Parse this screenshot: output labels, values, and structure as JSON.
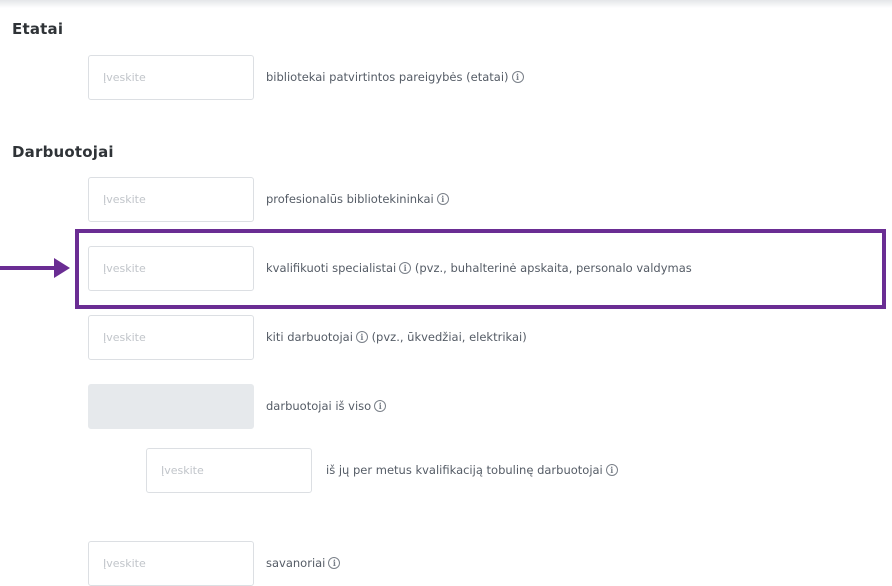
{
  "sections": {
    "etatai": {
      "title": "Etatai"
    },
    "darbuotojai": {
      "title": "Darbuotojai"
    }
  },
  "placeholder": "Įveskite",
  "info_glyph": "i",
  "fields": {
    "etatai": "bibliotekai patvirtintos pareigybės (etatai)",
    "profesionalus": "profesionalūs bibliotekininkai",
    "kvalifikuoti": "kvalifikuoti specialistai",
    "kvalifikuoti_note": "(pvz., buhalterinė apskaita, personalo valdymas",
    "kiti": "kiti darbuotojai",
    "kiti_note": "(pvz., ūkvedžiai, elektrikai)",
    "viso": "darbuotojai iš viso",
    "tobulino": "iš jų per metus kvalifikaciją tobulinę darbuotojai",
    "savanoriai": "savanoriai"
  },
  "annotation": {
    "color": "#6a2d93",
    "icon": "arrow-right-icon"
  }
}
